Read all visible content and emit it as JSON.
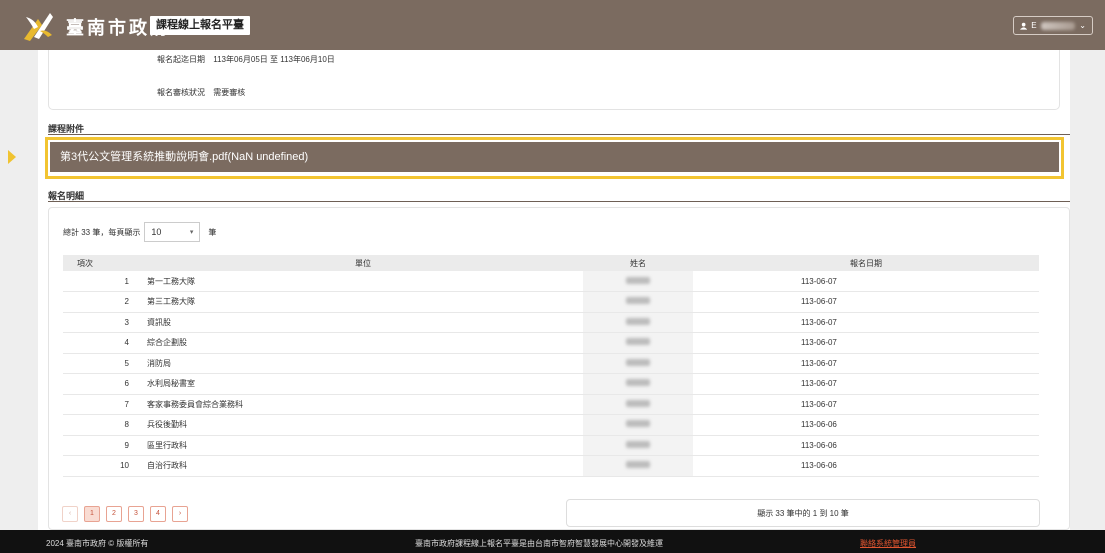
{
  "header": {
    "brand": "臺南市政府",
    "app_name": "課程線上報名平臺",
    "user_initial": "E",
    "user_chevron": "⌄"
  },
  "info": {
    "period_label": "報名起迄日期",
    "period_value": "113年06月05日 至 113年06月10日",
    "review_label": "報名審核狀況",
    "review_value": "需要審核"
  },
  "attachments": {
    "title": "課程附件",
    "file_label": "第3代公文管理系統推動說明會.pdf(NaN undefined)"
  },
  "details": {
    "title": "報名明細",
    "count_prefix": "總計 33 筆，每頁顯示",
    "page_size": "10",
    "count_suffix": "筆",
    "columns": {
      "idx": "項次",
      "unit": "單位",
      "name": "姓名",
      "date": "報名日期"
    },
    "rows": [
      {
        "idx": "1",
        "unit": "第一工務大隊",
        "date": "113-06-07"
      },
      {
        "idx": "2",
        "unit": "第三工務大隊",
        "date": "113-06-07"
      },
      {
        "idx": "3",
        "unit": "資訊股",
        "date": "113-06-07"
      },
      {
        "idx": "4",
        "unit": "綜合企劃股",
        "date": "113-06-07"
      },
      {
        "idx": "5",
        "unit": "消防局",
        "date": "113-06-07"
      },
      {
        "idx": "6",
        "unit": "水利局秘書室",
        "date": "113-06-07"
      },
      {
        "idx": "7",
        "unit": "客家事務委員會綜合業務科",
        "date": "113-06-07"
      },
      {
        "idx": "8",
        "unit": "兵役後勤科",
        "date": "113-06-06"
      },
      {
        "idx": "9",
        "unit": "區里行政科",
        "date": "113-06-06"
      },
      {
        "idx": "10",
        "unit": "自治行政科",
        "date": "113-06-06"
      }
    ],
    "pager": {
      "prev": "‹",
      "pages": [
        "1",
        "2",
        "3",
        "4"
      ],
      "next": "›"
    },
    "summary": "顯示 33 筆中的 1 到 10 筆"
  },
  "footer": {
    "copyright": "2024 臺南市政府 © 版權所有",
    "credit": "臺南市政府課程線上報名平臺是由台南市智府智慧發展中心開發及維運",
    "contact_link": "聯絡系統管理員"
  },
  "colors": {
    "header_bg": "#7b6b60",
    "highlight": "#f2c431",
    "pager_accent": "#c5523a"
  }
}
